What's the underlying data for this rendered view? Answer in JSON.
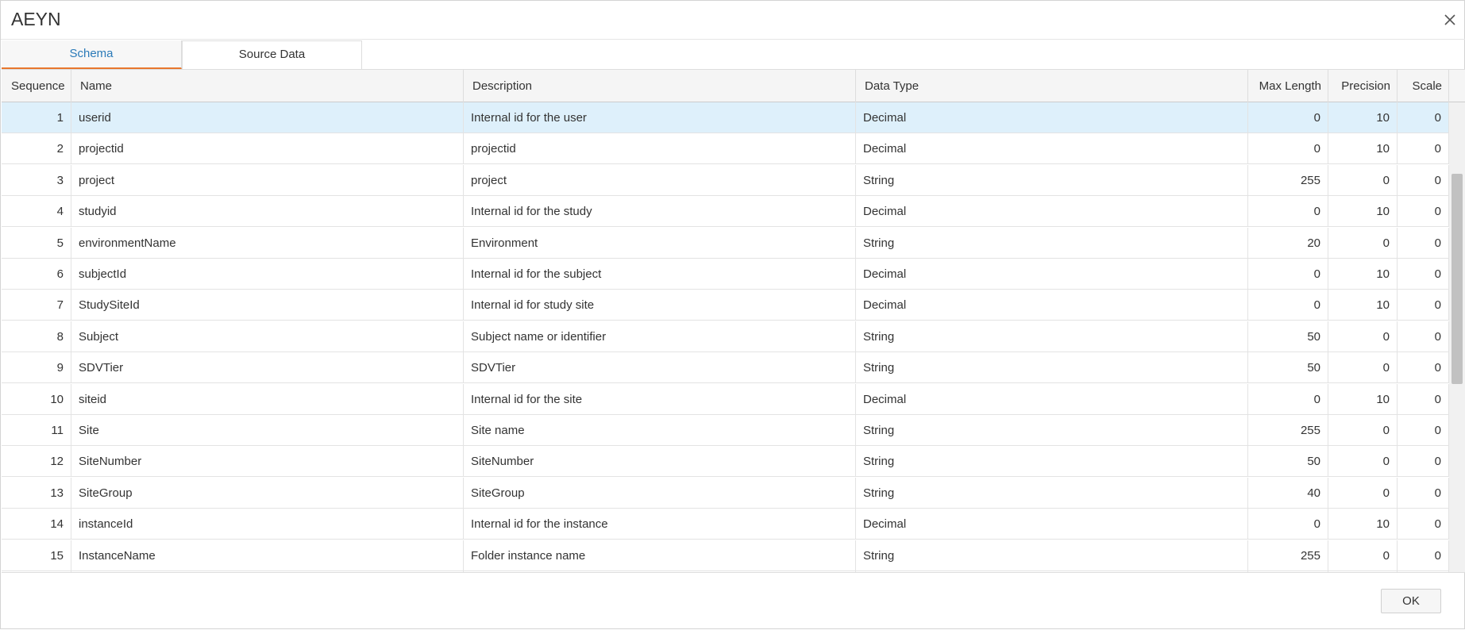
{
  "dialog": {
    "title": "AEYN",
    "ok_label": "OK"
  },
  "tabs": [
    {
      "label": "Schema",
      "active": true
    },
    {
      "label": "Source Data",
      "active": false
    }
  ],
  "table": {
    "columns": [
      "Sequence",
      "Name",
      "Description",
      "Data Type",
      "Max Length",
      "Precision",
      "Scale"
    ],
    "rows": [
      {
        "sequence": "1",
        "name": "userid",
        "description": "Internal id for the user",
        "type": "Decimal",
        "max_length": "0",
        "precision": "10",
        "scale": "0"
      },
      {
        "sequence": "2",
        "name": "projectid",
        "description": "projectid",
        "type": "Decimal",
        "max_length": "0",
        "precision": "10",
        "scale": "0"
      },
      {
        "sequence": "3",
        "name": "project",
        "description": "project",
        "type": "String",
        "max_length": "255",
        "precision": "0",
        "scale": "0"
      },
      {
        "sequence": "4",
        "name": "studyid",
        "description": "Internal id for the study",
        "type": "Decimal",
        "max_length": "0",
        "precision": "10",
        "scale": "0"
      },
      {
        "sequence": "5",
        "name": "environmentName",
        "description": "Environment",
        "type": "String",
        "max_length": "20",
        "precision": "0",
        "scale": "0"
      },
      {
        "sequence": "6",
        "name": "subjectId",
        "description": "Internal id for the subject",
        "type": "Decimal",
        "max_length": "0",
        "precision": "10",
        "scale": "0"
      },
      {
        "sequence": "7",
        "name": "StudySiteId",
        "description": "Internal id for study site",
        "type": "Decimal",
        "max_length": "0",
        "precision": "10",
        "scale": "0"
      },
      {
        "sequence": "8",
        "name": "Subject",
        "description": "Subject name or identifier",
        "type": "String",
        "max_length": "50",
        "precision": "0",
        "scale": "0"
      },
      {
        "sequence": "9",
        "name": "SDVTier",
        "description": "SDVTier",
        "type": "String",
        "max_length": "50",
        "precision": "0",
        "scale": "0"
      },
      {
        "sequence": "10",
        "name": "siteid",
        "description": "Internal id for the site",
        "type": "Decimal",
        "max_length": "0",
        "precision": "10",
        "scale": "0"
      },
      {
        "sequence": "11",
        "name": "Site",
        "description": "Site name",
        "type": "String",
        "max_length": "255",
        "precision": "0",
        "scale": "0"
      },
      {
        "sequence": "12",
        "name": "SiteNumber",
        "description": "SiteNumber",
        "type": "String",
        "max_length": "50",
        "precision": "0",
        "scale": "0"
      },
      {
        "sequence": "13",
        "name": "SiteGroup",
        "description": "SiteGroup",
        "type": "String",
        "max_length": "40",
        "precision": "0",
        "scale": "0"
      },
      {
        "sequence": "14",
        "name": "instanceId",
        "description": "Internal id for the instance",
        "type": "Decimal",
        "max_length": "0",
        "precision": "10",
        "scale": "0"
      },
      {
        "sequence": "15",
        "name": "InstanceName",
        "description": "Folder instance name",
        "type": "String",
        "max_length": "255",
        "precision": "0",
        "scale": "0"
      }
    ],
    "selected_row": 1
  },
  "colors": {
    "accent": "#e8772e",
    "active_tab_text": "#2a7ab8",
    "selected_row": "#def0fb"
  },
  "icons": {
    "close": "close-icon"
  }
}
